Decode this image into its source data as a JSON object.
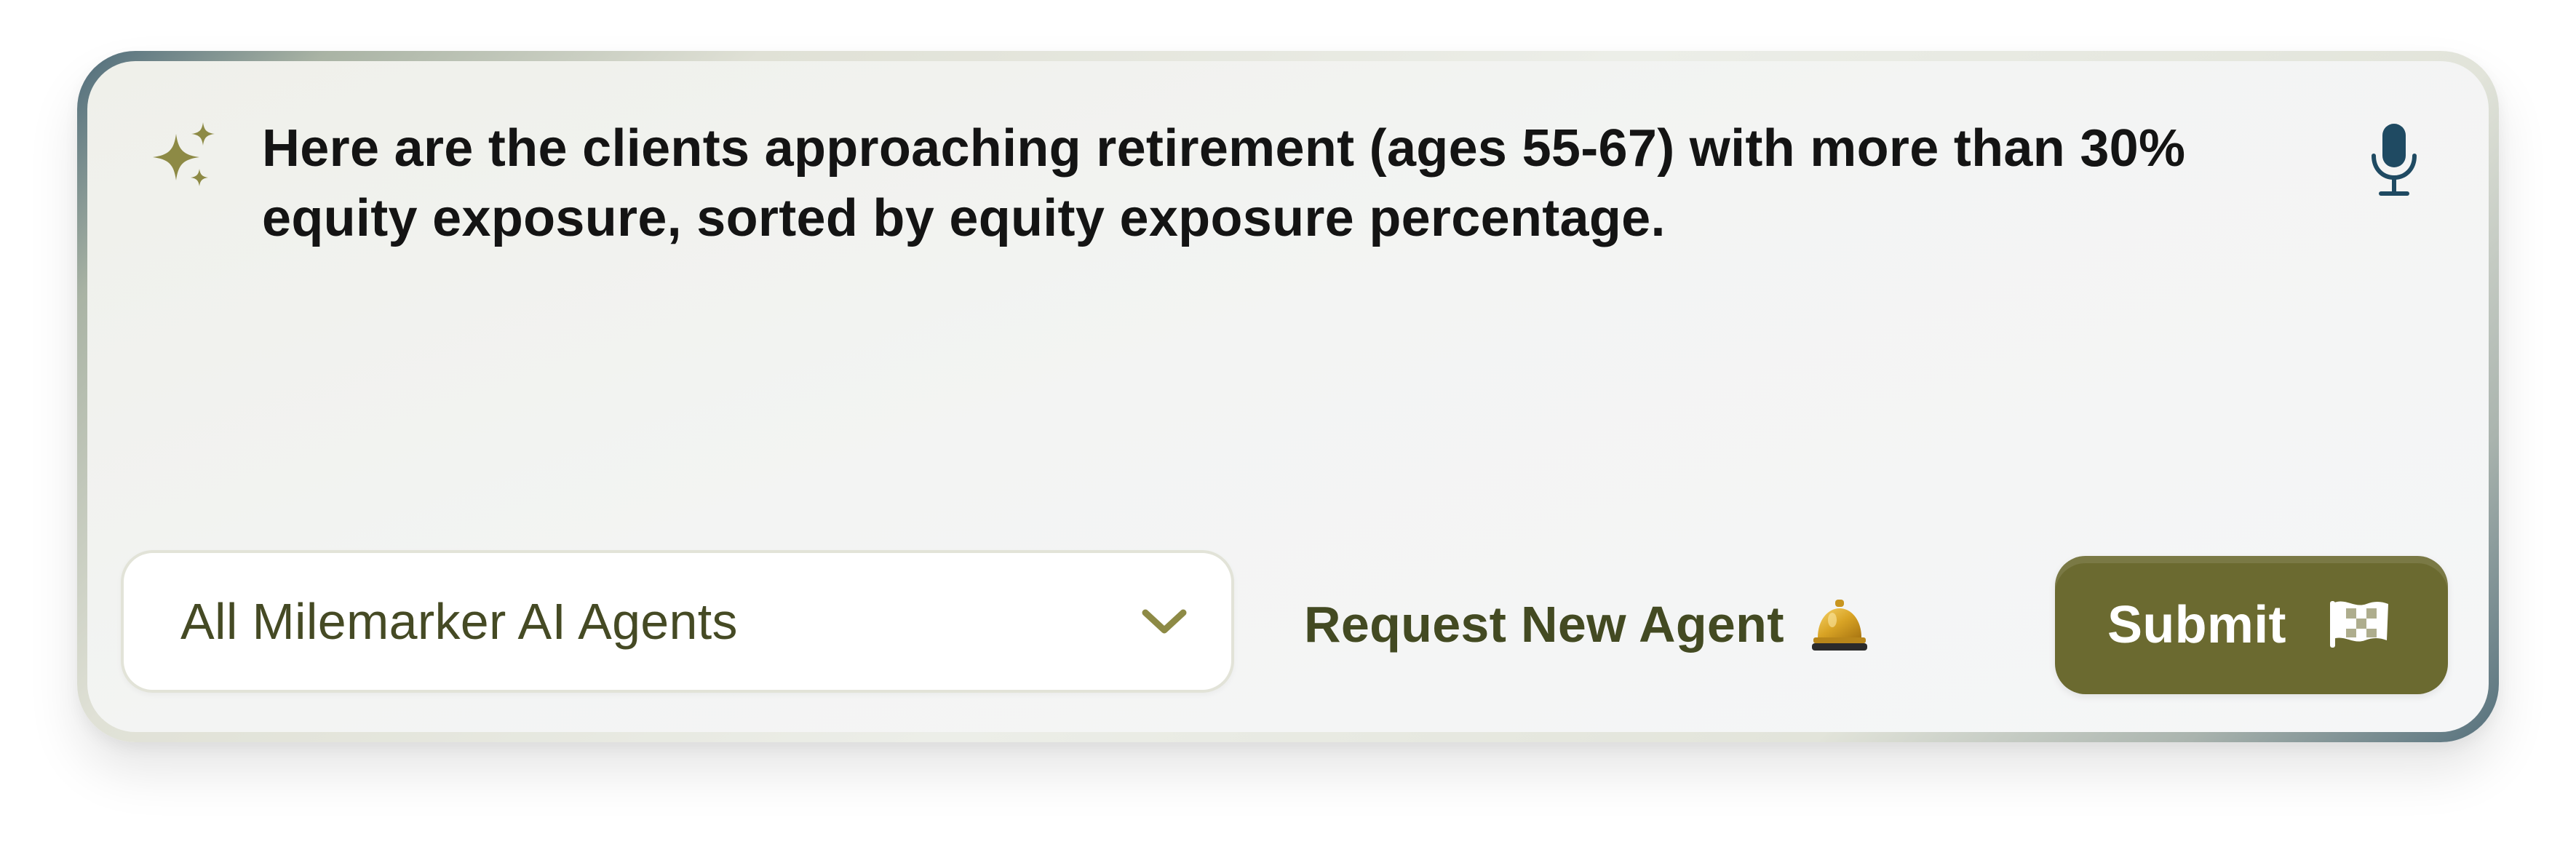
{
  "prompt": {
    "text": "Here are the clients approaching retirement (ages 55-67) with more than 30% equity exposure, sorted by equity exposure percentage.",
    "leading_icon": "sparkle-icon",
    "trailing_icon": "microphone-icon"
  },
  "agent_select": {
    "selected": "All Milemarker AI Agents",
    "icon": "chevron-down-icon"
  },
  "request_agent": {
    "label": "Request New Agent",
    "icon": "service-bell-icon"
  },
  "submit": {
    "label": "Submit",
    "icon": "checkered-flag-icon"
  },
  "colors": {
    "accent_olive": "#6b6a30",
    "sparkle_olive": "#8d8a45",
    "text_olive": "#454a24",
    "mic_navy": "#1f4a62",
    "prompt_text": "#141414"
  }
}
